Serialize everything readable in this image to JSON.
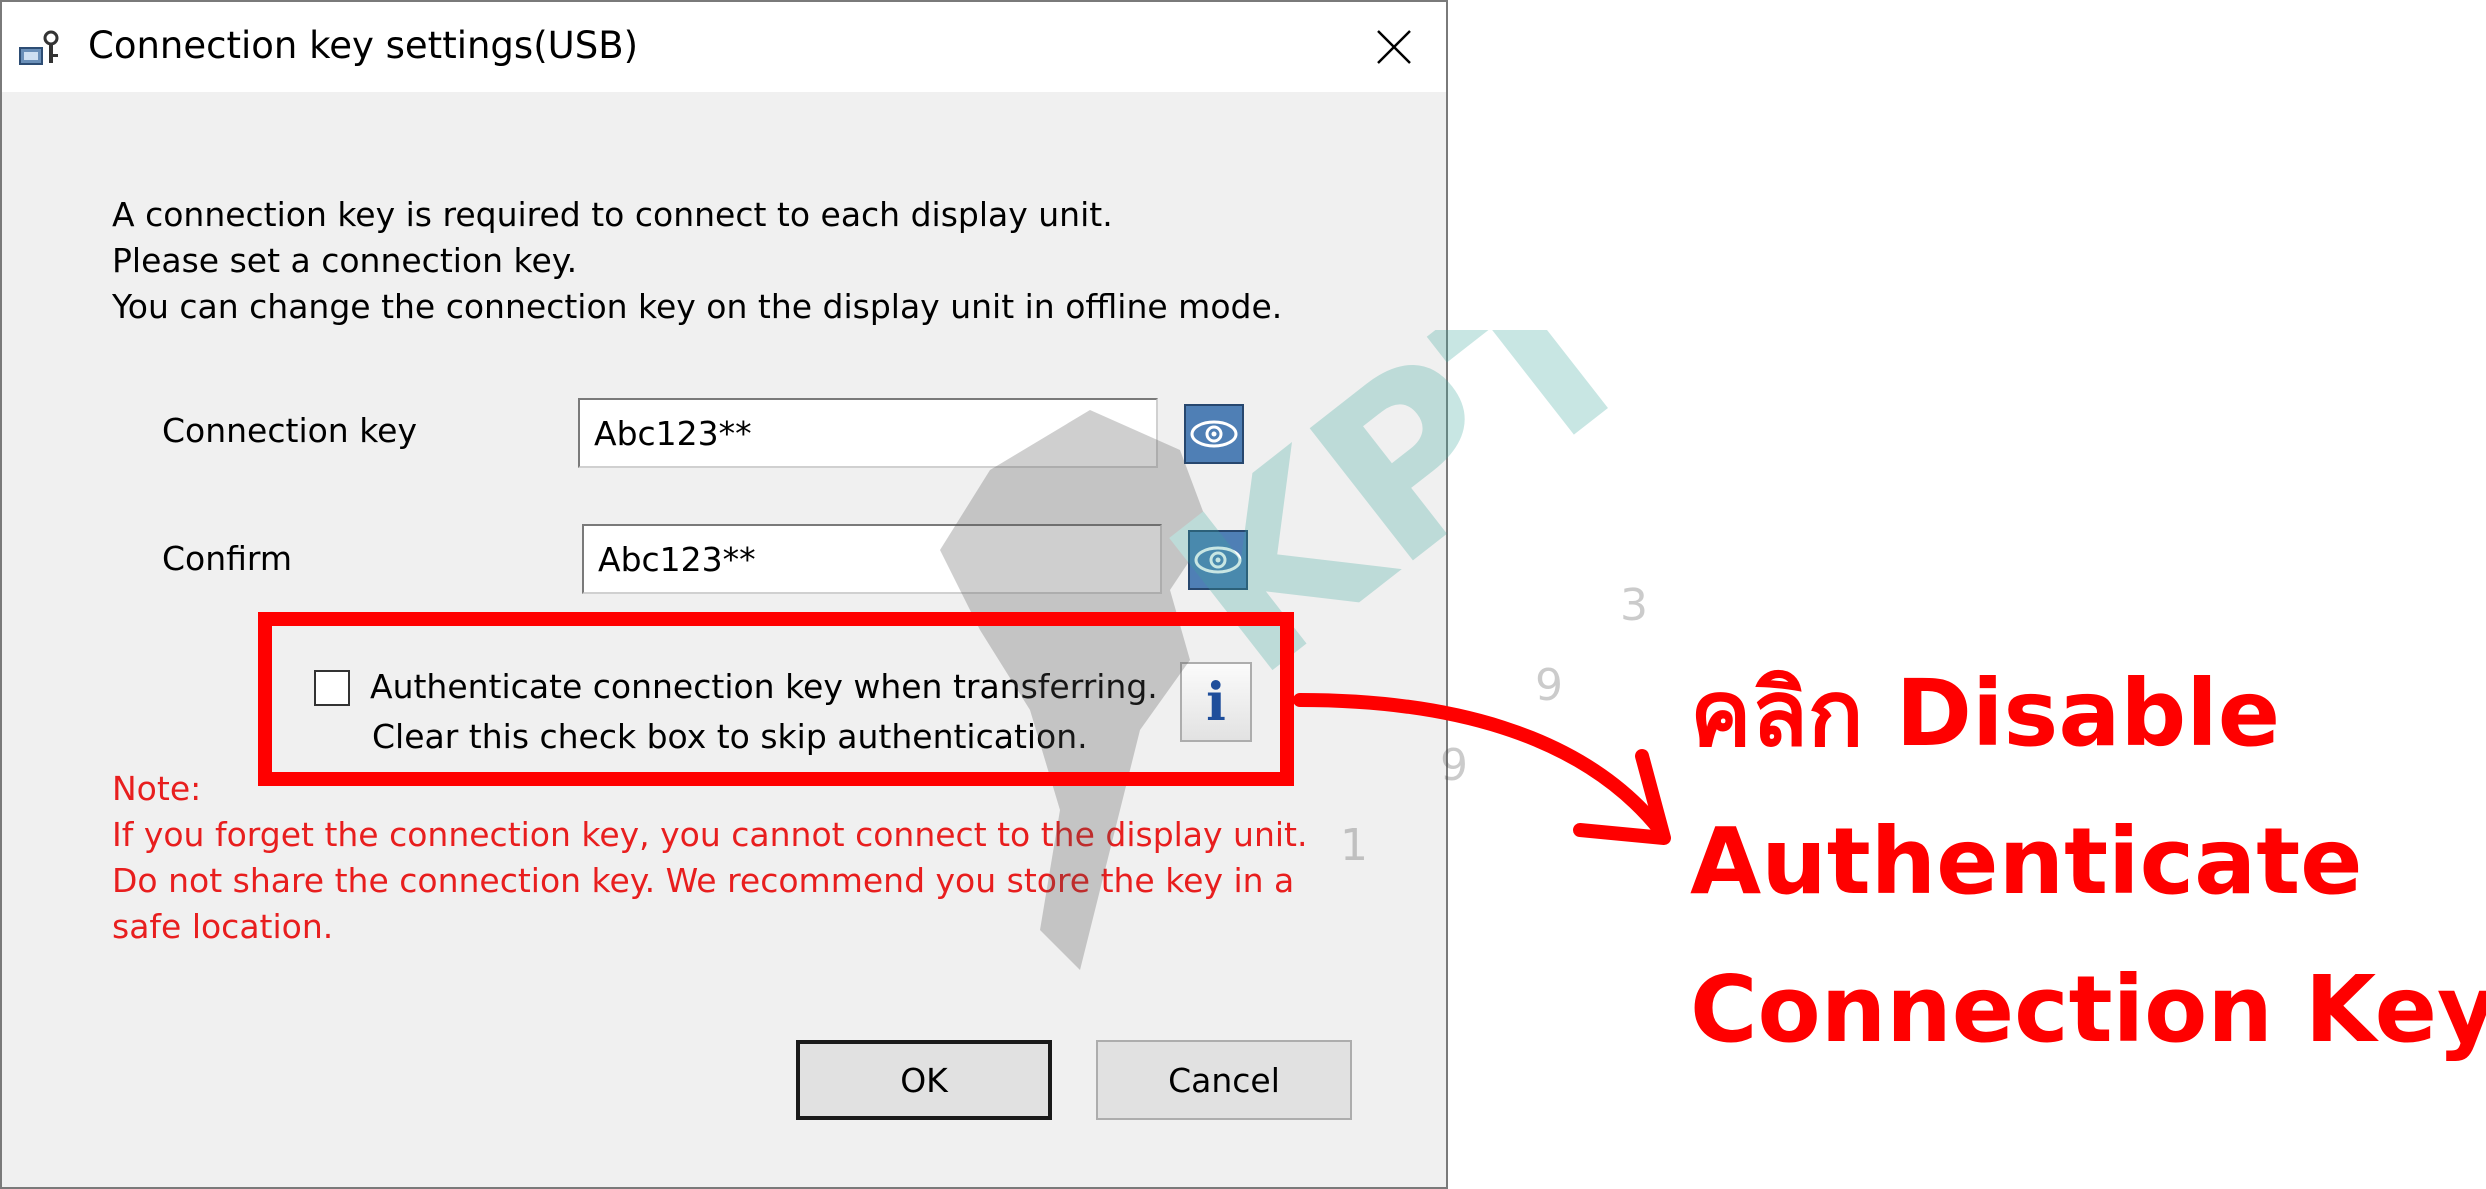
{
  "window": {
    "title": "Connection key settings(USB)",
    "icon": "usb-key-icon",
    "close_icon": "close-icon"
  },
  "intro": {
    "lines": [
      "A connection key is required to connect to each display unit.",
      "Please set a connection key.",
      "You can change the connection key on the display unit in offline mode."
    ]
  },
  "form": {
    "connection_key": {
      "label": "Connection key",
      "value": "Abc123**",
      "toggle_icon": "eye-icon"
    },
    "confirm": {
      "label": "Confirm",
      "value": "Abc123**",
      "toggle_icon": "eye-icon"
    }
  },
  "authenticate": {
    "checked": false,
    "line1": "Authenticate connection key when transferring.",
    "line2": "Clear this check box to skip authentication.",
    "info_label": "i"
  },
  "note": {
    "heading": "Note:",
    "lines": [
      "If you forget the connection key, you cannot connect to the display unit.",
      "Do not share the connection key. We recommend you store the key in a",
      "safe location."
    ]
  },
  "buttons": {
    "ok": "OK",
    "cancel": "Cancel"
  },
  "annotation": {
    "lines": [
      "คลิก Disable",
      "Authenticate",
      "Connection Key"
    ],
    "color": "#ff0000"
  },
  "watermark": {
    "text": "KPT",
    "digits": [
      "3",
      "9",
      "9",
      "1"
    ]
  },
  "colors": {
    "note_red": "#e81e1e",
    "eye_button": "#4f7fb5",
    "info_blue": "#1f4e9b"
  }
}
